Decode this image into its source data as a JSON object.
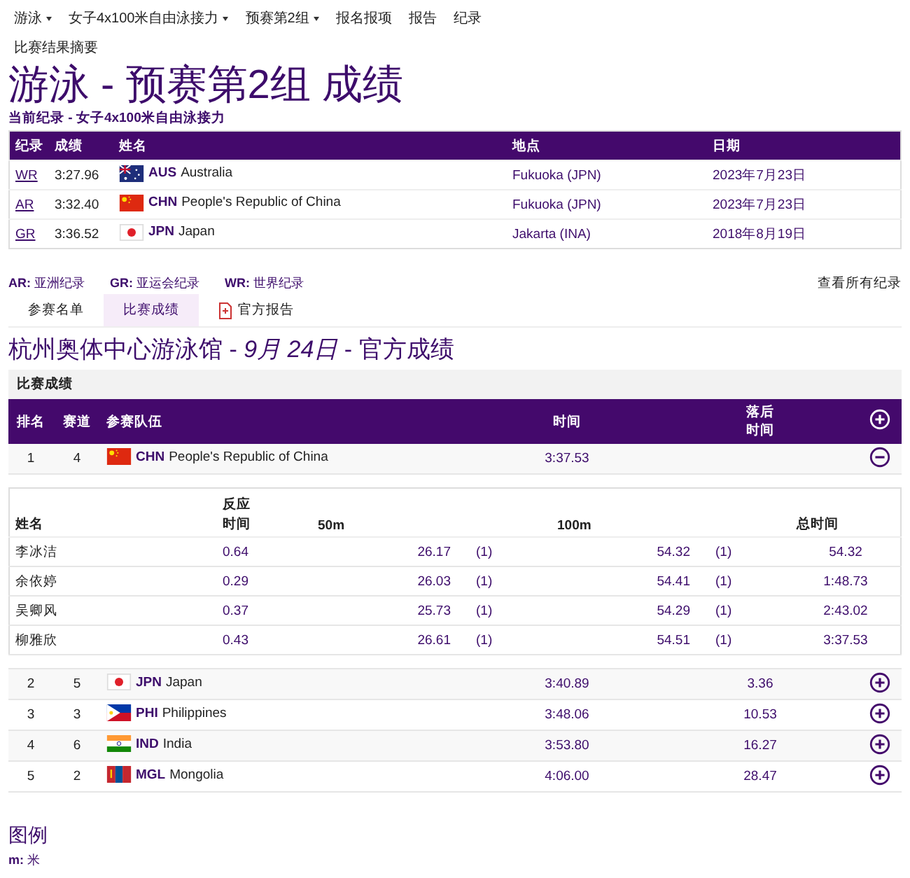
{
  "nav": [
    {
      "label": "游泳",
      "dropdown": true
    },
    {
      "label": "女子4x100米自由泳接力",
      "dropdown": true
    },
    {
      "label": "预赛第2组",
      "dropdown": true
    },
    {
      "label": "报名报项",
      "dropdown": false
    },
    {
      "label": "报告",
      "dropdown": false
    },
    {
      "label": "纪录",
      "dropdown": false
    }
  ],
  "subnav": "比赛结果摘要",
  "title": "游泳 - 预赛第2组 成绩",
  "records_heading": "当前纪录 - 女子4x100米自由泳接力",
  "records": {
    "columns": [
      "纪录",
      "成绩",
      "姓名",
      "地点",
      "日期"
    ],
    "rows": [
      {
        "code": "WR",
        "result": "3:27.96",
        "kind": "au",
        "noc": "AUS",
        "name": "Australia",
        "venue": "Fukuoka (JPN)",
        "date": "2023年7月23日"
      },
      {
        "code": "AR",
        "result": "3:32.40",
        "kind": "cn",
        "noc": "CHN",
        "name": "People's Republic of China",
        "venue": "Fukuoka (JPN)",
        "date": "2023年7月23日"
      },
      {
        "code": "GR",
        "result": "3:36.52",
        "kind": "jp",
        "noc": "JPN",
        "name": "Japan",
        "venue": "Jakarta (INA)",
        "date": "2018年8月19日"
      }
    ]
  },
  "legend": [
    {
      "abbr": "AR:",
      "text": "亚洲纪录"
    },
    {
      "abbr": "GR:",
      "text": "亚运会纪录"
    },
    {
      "abbr": "WR:",
      "text": "世界纪录"
    }
  ],
  "all_records_link": "查看所有纪录",
  "tabs": [
    {
      "label": "参赛名单",
      "selected": false,
      "icon": false
    },
    {
      "label": "比赛成绩",
      "selected": true,
      "icon": false
    },
    {
      "label": "官方报告",
      "selected": false,
      "icon": true
    }
  ],
  "venue_title": "杭州奥体中心游泳馆 - *9月 24日* - 官方成绩",
  "section": "比赛成绩",
  "results": {
    "columns": [
      "排名",
      "赛道",
      "参赛队伍",
      "时间",
      "落后时间"
    ],
    "rows": [
      {
        "rank": "1",
        "lane": "4",
        "kind": "cn",
        "noc": "CHN",
        "name": "People's Republic of China",
        "time": "3:37.53",
        "expanded": true,
        "splits": {
          "columns": [
            "姓名",
            "反应时间",
            "50m",
            "100m",
            "总时间"
          ],
          "rows": [
            {
              "name": "李冰洁",
              "reaction": "0.64",
              "s50": "26.17",
              "r50": "(1)",
              "s100": "54.32",
              "r100": "(1)",
              "total": "54.32"
            },
            {
              "name": "余依婷",
              "reaction": "0.29",
              "s50": "26.03",
              "r50": "(1)",
              "s100": "54.41",
              "r100": "(1)",
              "total": "1:48.73"
            },
            {
              "name": "吴卿风",
              "reaction": "0.37",
              "s50": "25.73",
              "r50": "(1)",
              "s100": "54.29",
              "r100": "(1)",
              "total": "2:43.02"
            },
            {
              "name": "柳雅欣",
              "reaction": "0.43",
              "s50": "26.61",
              "r50": "(1)",
              "s100": "54.51",
              "r100": "(1)",
              "total": "3:37.53"
            }
          ]
        }
      },
      {
        "rank": "2",
        "lane": "5",
        "kind": "jp",
        "noc": "JPN",
        "name": "Japan",
        "time": "3:40.89",
        "behind": "3.36",
        "expanded": false
      },
      {
        "rank": "3",
        "lane": "3",
        "kind": "ph",
        "noc": "PHI",
        "name": "Philippines",
        "time": "3:48.06",
        "behind": "10.53",
        "expanded": false
      },
      {
        "rank": "4",
        "lane": "6",
        "kind": "in",
        "noc": "IND",
        "name": "India",
        "time": "3:53.80",
        "behind": "16.27",
        "expanded": false
      },
      {
        "rank": "5",
        "lane": "2",
        "kind": "mn",
        "noc": "MGL",
        "name": "Mongolia",
        "time": "4:06.00",
        "behind": "28.47",
        "expanded": false
      }
    ]
  },
  "footer": {
    "title": "图例",
    "abbr": "m:",
    "text": "米"
  }
}
